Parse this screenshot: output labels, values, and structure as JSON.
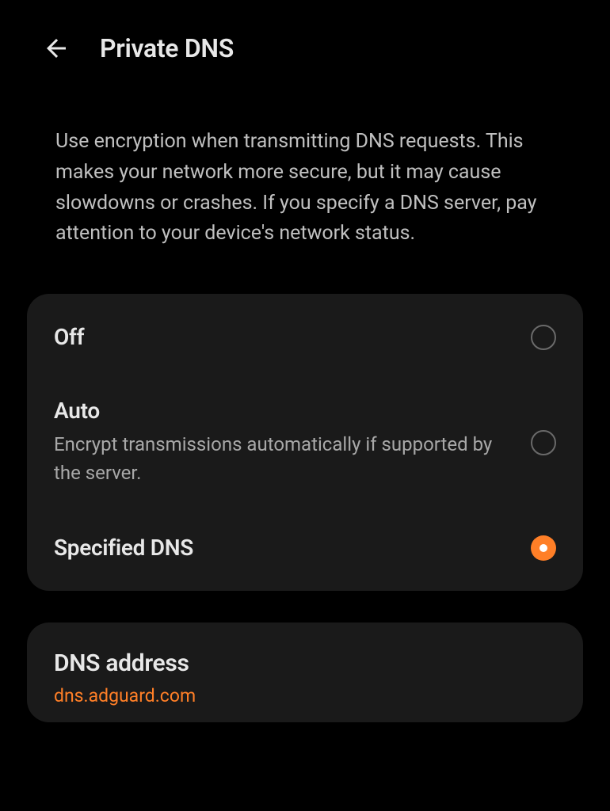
{
  "header": {
    "title": "Private DNS"
  },
  "description": "Use encryption when transmitting DNS requests. This makes your network more secure, but it may cause slowdowns or crashes. If you specify a DNS server, pay attention to your device's network status.",
  "options": {
    "off": {
      "title": "Off",
      "selected": false
    },
    "auto": {
      "title": "Auto",
      "subtitle": "Encrypt transmissions automatically if supported by the server.",
      "selected": false
    },
    "specified": {
      "title": "Specified DNS",
      "selected": true
    }
  },
  "dns_address": {
    "label": "DNS address",
    "value": "dns.adguard.com"
  },
  "colors": {
    "accent": "#ff7f27",
    "background": "#000000",
    "card": "#1a1a1a",
    "text_primary": "#e8e8e8",
    "text_secondary": "#a8a8a8"
  }
}
